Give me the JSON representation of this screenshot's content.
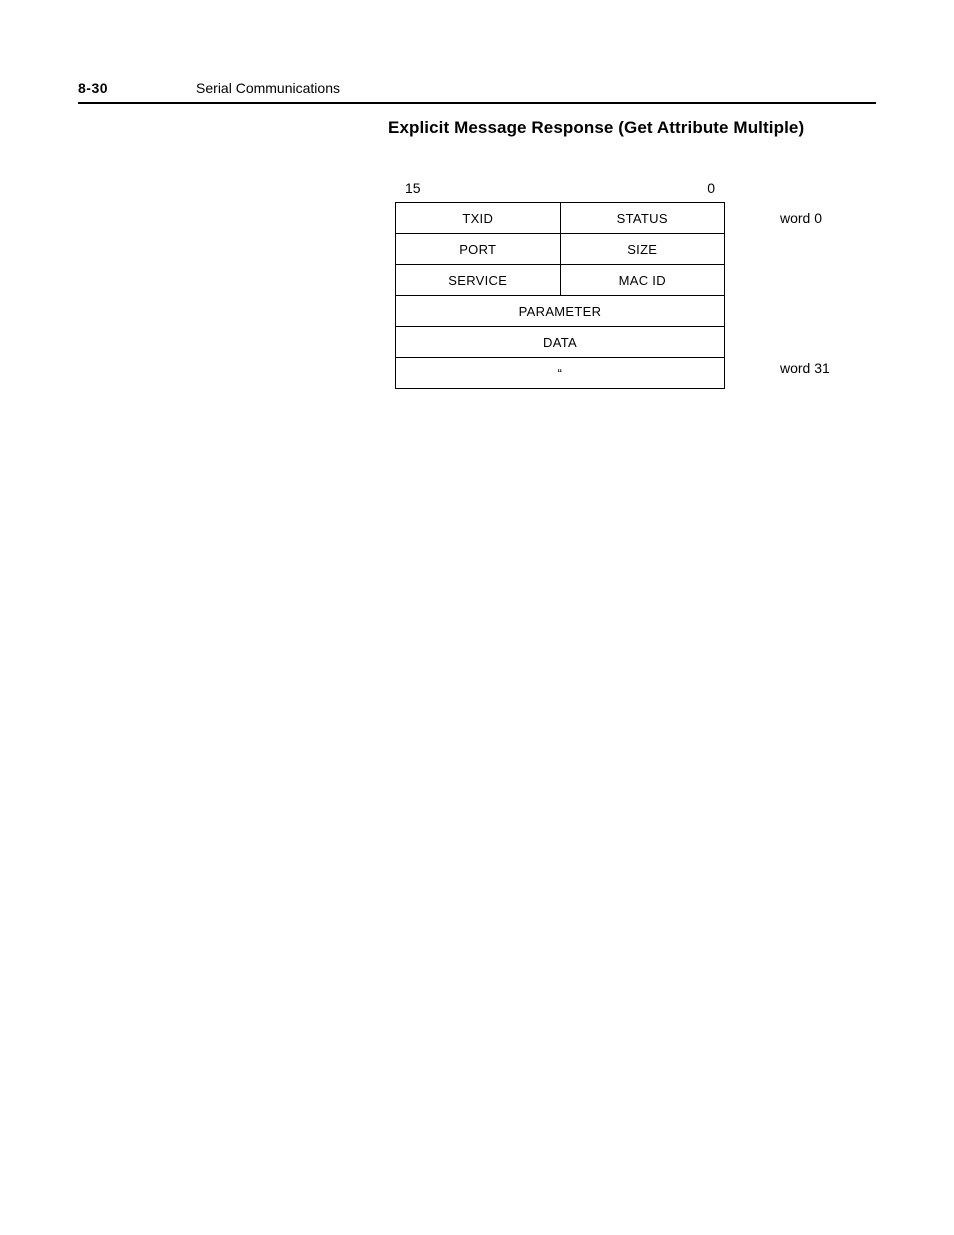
{
  "header": {
    "page_number": "8-30",
    "section": "Serial Communications"
  },
  "subheading": "Explicit Message Response (Get Attribute Multiple)",
  "diagram": {
    "bit_high": "15",
    "bit_low": "0",
    "rows": [
      {
        "left": "TXID",
        "right": "STATUS",
        "span": "split",
        "word_label": "word 0"
      },
      {
        "left": "PORT",
        "right": "SIZE",
        "span": "split"
      },
      {
        "left": "SERVICE",
        "right": "MAC ID",
        "span": "split"
      },
      {
        "full": "PARAMETER",
        "span": "full"
      },
      {
        "full": "DATA",
        "span": "full"
      },
      {
        "full": "“",
        "span": "full",
        "word_label": "word 31"
      }
    ]
  }
}
